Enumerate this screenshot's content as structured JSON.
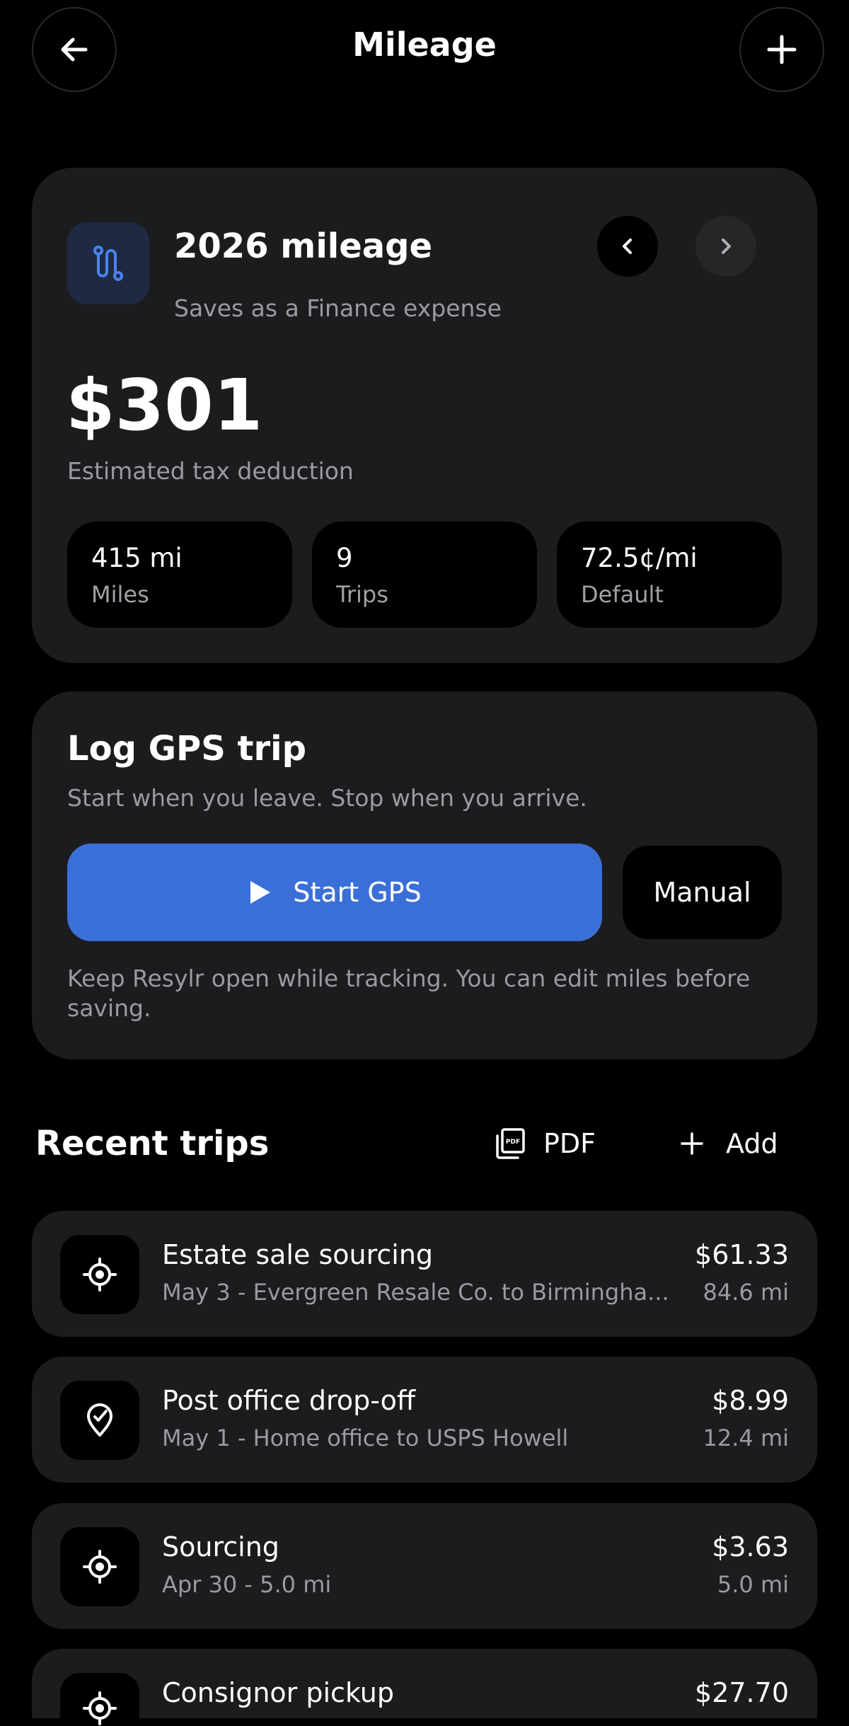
{
  "header": {
    "title": "Mileage"
  },
  "summary": {
    "title": "2026 mileage",
    "subtitle": "Saves as a Finance expense",
    "amount": "$301",
    "amount_label": "Estimated tax deduction",
    "stats": [
      {
        "value": "415 mi",
        "label": "Miles"
      },
      {
        "value": "9",
        "label": "Trips"
      },
      {
        "value": "72.5¢/mi",
        "label": "Default"
      }
    ]
  },
  "gps": {
    "title": "Log GPS trip",
    "subtitle": "Start when you leave. Stop when you arrive.",
    "start_label": "Start GPS",
    "manual_label": "Manual",
    "note": "Keep Resylr open while tracking. You can edit miles before saving."
  },
  "recent": {
    "title": "Recent trips",
    "pdf_label": "PDF",
    "add_label": "Add",
    "trips": [
      {
        "title": "Estate sale sourcing",
        "subtitle": "May 3 - Evergreen Resale Co. to Birmingha...",
        "amount": "$61.33",
        "miles": "84.6 mi",
        "icon": "crosshair-icon"
      },
      {
        "title": "Post office drop-off",
        "subtitle": "May 1 - Home office to USPS Howell",
        "amount": "$8.99",
        "miles": "12.4 mi",
        "icon": "location-check-icon"
      },
      {
        "title": "Sourcing",
        "subtitle": "Apr 30 - 5.0 mi",
        "amount": "$3.63",
        "miles": "5.0 mi",
        "icon": "crosshair-icon"
      },
      {
        "title": "Consignor pickup",
        "subtitle": "",
        "amount": "$27.70",
        "miles": "",
        "icon": "crosshair-icon"
      }
    ]
  },
  "colors": {
    "accent": "#3b6fd8",
    "card": "#1c1c1e",
    "icon_tile": "#1e2a44",
    "icon_blue": "#4b82f0"
  }
}
